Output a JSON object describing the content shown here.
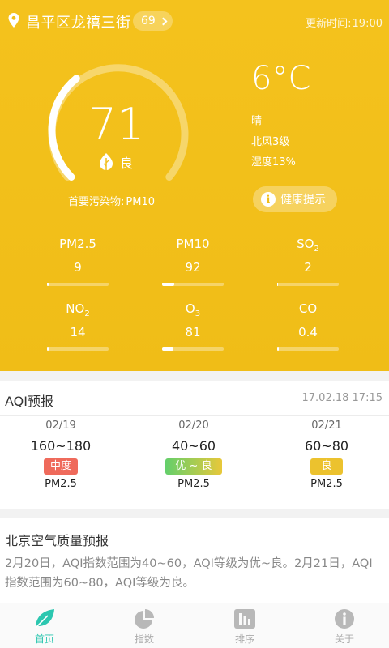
{
  "location": {
    "name": "昌平区龙禧三街",
    "aqi_badge": "69",
    "update_label": "更新时间:",
    "update_time": "19:00"
  },
  "aqi": {
    "value": "71",
    "level": "良",
    "gauge_fraction": 0.355,
    "pollutant_label": "首要污染物:",
    "pollutant": "PM10"
  },
  "weather": {
    "temp": "6°C",
    "condition": "晴",
    "wind": "北风3级",
    "humidity": "湿度13%",
    "health_button": "健康提示"
  },
  "pollutants": [
    {
      "name": "PM2.5",
      "sub": "",
      "value": "9",
      "fraction": 0.02
    },
    {
      "name": "PM10",
      "sub": "",
      "value": "92",
      "fraction": 0.2
    },
    {
      "name": "SO",
      "sub": "2",
      "value": "2",
      "fraction": 0.01
    },
    {
      "name": "NO",
      "sub": "2",
      "value": "14",
      "fraction": 0.03
    },
    {
      "name": "O",
      "sub": "3",
      "value": "81",
      "fraction": 0.18
    },
    {
      "name": "CO",
      "sub": "",
      "value": "0.4",
      "fraction": 0.03
    }
  ],
  "forecast": {
    "title": "AQI预报",
    "timestamp": "17.02.18 17:15",
    "days": [
      {
        "date": "02/19",
        "range": "160~180",
        "level": "中度",
        "color": "#ef6a5b",
        "pollutant": "PM2.5"
      },
      {
        "date": "02/20",
        "range": "40~60",
        "level": "优 ~ 良",
        "color": "linear-gradient(90deg,#63cf6b,#e8c83a)",
        "pollutant": "PM2.5"
      },
      {
        "date": "02/21",
        "range": "60~80",
        "level": "良",
        "color": "#ecc22e",
        "pollutant": "PM2.5"
      }
    ]
  },
  "report": {
    "title": "北京空气质量预报",
    "text": "2月20日，AQI指数范围为40~60，AQI等级为优~良。2月21日，AQI指数范围为60~80，AQI等级为良。"
  },
  "tabs": [
    {
      "label": "首页",
      "icon": "leaf-icon",
      "active": true
    },
    {
      "label": "指数",
      "icon": "pie-chart-icon",
      "active": false
    },
    {
      "label": "排序",
      "icon": "ranking-icon",
      "active": false
    },
    {
      "label": "关于",
      "icon": "info-icon",
      "active": false
    }
  ],
  "colors": {
    "hero": "#f2bf1a",
    "accent": "#2cc7b0"
  }
}
